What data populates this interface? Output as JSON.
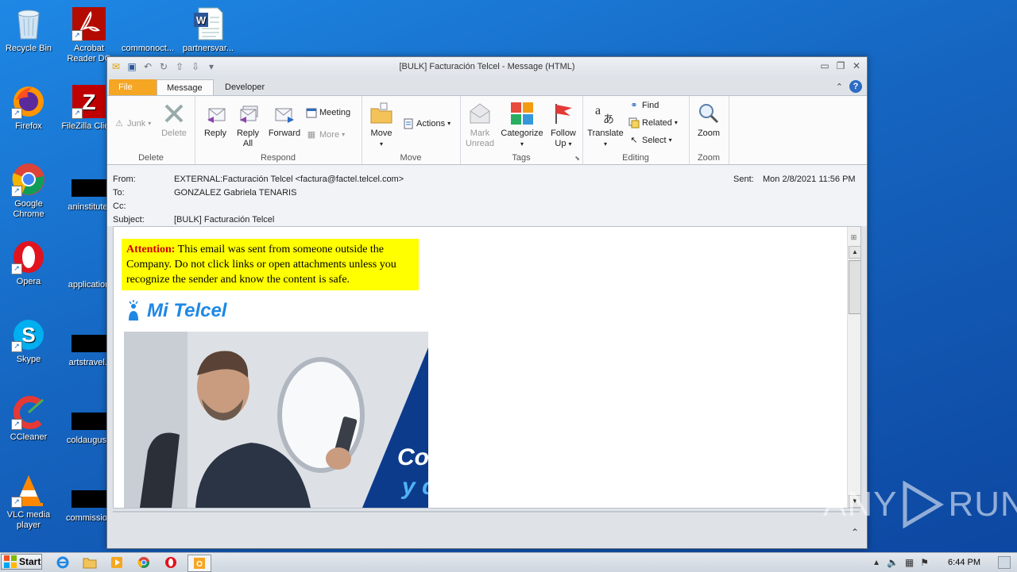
{
  "desktop": {
    "icons_left": [
      {
        "label": "Recycle Bin",
        "icon": "recycle-bin-icon"
      },
      {
        "label": "Firefox",
        "icon": "firefox-icon"
      },
      {
        "label": "Google Chrome",
        "icon": "chrome-icon"
      },
      {
        "label": "Opera",
        "icon": "opera-icon"
      },
      {
        "label": "Skype",
        "icon": "skype-icon"
      },
      {
        "label": "CCleaner",
        "icon": "ccleaner-icon"
      },
      {
        "label": "VLC media player",
        "icon": "vlc-icon"
      }
    ],
    "icons_col2": [
      {
        "label": "Acrobat Reader DC",
        "icon": "acrobat-icon"
      },
      {
        "label": "FileZilla Client",
        "icon": "filezilla-icon"
      },
      {
        "label": "aninstitute.",
        "icon": "file-icon"
      },
      {
        "label": "application",
        "icon": "file-icon"
      },
      {
        "label": "artstravel.j",
        "icon": "file-icon"
      },
      {
        "label": "coldaugust.",
        "icon": "file-icon"
      },
      {
        "label": "commission",
        "icon": "file-icon"
      }
    ],
    "icons_top": [
      {
        "label": "commonoct...",
        "icon": "file-icon"
      },
      {
        "label": "partnersvar...",
        "icon": "word-doc-icon"
      }
    ]
  },
  "window": {
    "title": "[BULK] Facturación Telcel - Message (HTML)",
    "tabs": {
      "file": "File",
      "message": "Message",
      "developer": "Developer"
    }
  },
  "ribbon": {
    "delete_group": {
      "label": "Delete",
      "junk": "Junk",
      "delete": "Delete"
    },
    "respond_group": {
      "label": "Respond",
      "reply": "Reply",
      "reply_all_1": "Reply",
      "reply_all_2": "All",
      "forward": "Forward",
      "meeting": "Meeting",
      "more": "More"
    },
    "move_group": {
      "label": "Move",
      "move": "Move",
      "actions": "Actions"
    },
    "tags_group": {
      "label": "Tags",
      "mark_unread_1": "Mark",
      "mark_unread_2": "Unread",
      "categorize": "Categorize",
      "follow_up_1": "Follow",
      "follow_up_2": "Up"
    },
    "editing_group": {
      "label": "Editing",
      "translate": "Translate",
      "find": "Find",
      "related": "Related",
      "select": "Select"
    },
    "zoom_group": {
      "label": "Zoom",
      "zoom": "Zoom"
    }
  },
  "header": {
    "from_label": "From:",
    "from_value": "EXTERNAL:Facturación Telcel <factura@factel.telcel.com>",
    "to_label": "To:",
    "to_value": "GONZALEZ Gabriela TENARIS",
    "cc_label": "Cc:",
    "subject_label": "Subject:",
    "subject_value": "[BULK] Facturación Telcel",
    "sent_label": "Sent:",
    "sent_value": "Mon 2/8/2021 11:56 PM"
  },
  "body": {
    "warning_bold": "Attention:",
    "warning_text": " This email was sent from someone outside the Company. Do not click links or open attachments unless you recognize the sender and know the content is safe.",
    "logo_text": "Mi Telcel",
    "banner_text_1": "Co",
    "banner_text_2": "y c"
  },
  "taskbar": {
    "start": "Start",
    "clock": "6:44 PM"
  },
  "watermark": {
    "left": "ANY",
    "right": "RUN"
  },
  "colors": {
    "accent": "#1e88e5",
    "file_tab": "#f5a623",
    "warning_bg": "#ffff00",
    "warning_bold": "#d00000",
    "banner_blue": "#0d3b8c"
  }
}
